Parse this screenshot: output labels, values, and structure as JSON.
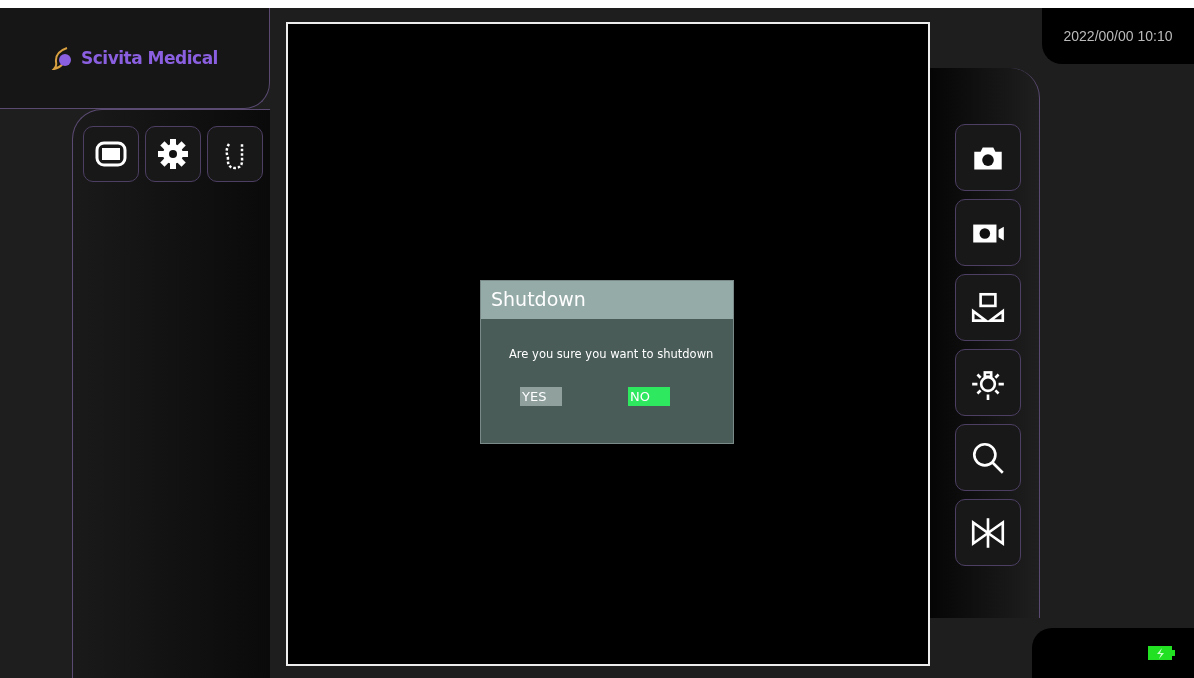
{
  "brand": {
    "name": "Scivita Medical"
  },
  "left_toolbar": [
    {
      "kind": "monitor"
    },
    {
      "kind": "gear"
    },
    {
      "kind": "scope"
    }
  ],
  "right_toolbar": [
    {
      "kind": "camera"
    },
    {
      "kind": "video"
    },
    {
      "kind": "keystone"
    },
    {
      "kind": "light"
    },
    {
      "kind": "zoom"
    },
    {
      "kind": "mirror"
    }
  ],
  "datetime": "2022/00/00 10:10",
  "dialog": {
    "title": "Shutdown",
    "message": "Are you sure you want to shutdown",
    "buttons": [
      {
        "label": "YES",
        "selected": false
      },
      {
        "label": "NO",
        "selected": true
      }
    ]
  },
  "battery": {
    "charging": true
  }
}
